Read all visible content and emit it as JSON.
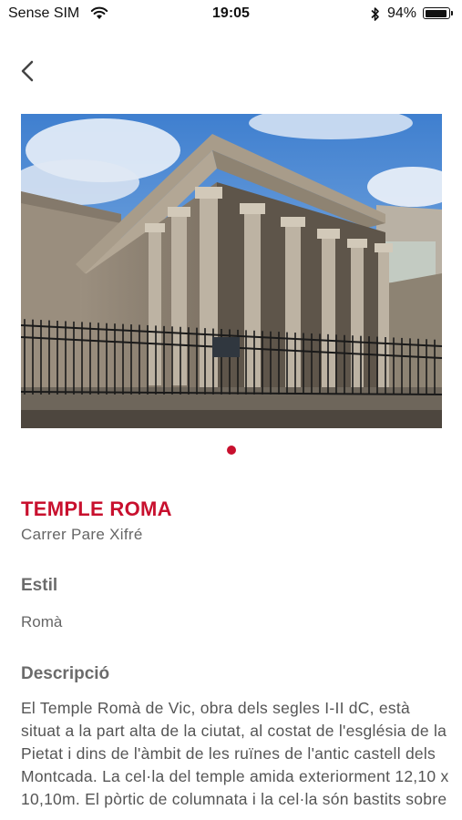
{
  "status_bar": {
    "carrier": "Sense SIM",
    "time": "19:05",
    "battery_percent": "94%",
    "battery_level": 0.94,
    "icons": [
      "wifi-icon",
      "bluetooth-icon",
      "battery-icon"
    ]
  },
  "nav": {
    "back_icon": "chevron-left-icon"
  },
  "carousel": {
    "image_subject": "Roman temple facade with columns behind iron fence",
    "page_count": 1,
    "active_page": 1
  },
  "monument": {
    "title": "TEMPLE ROMA",
    "address": "Carrer Pare Xifré",
    "style_heading": "Estil",
    "style_value": "Romà",
    "description_heading": "Descripció",
    "description": "El Temple Romà de Vic, obra dels segles I-II dC, està situat a la part alta de la ciutat, al costat de l'església de la Pietat i dins de l'àmbit de les ruïnes de l'antic castell dels Montcada. La cel·la del temple amida exteriorment 12,10 x 10,10m. El pòrtic de columnata i la cel·la són bastits sobre"
  },
  "colors": {
    "accent": "#c8102e",
    "heading": "#6b6b6b",
    "text": "#555555"
  }
}
